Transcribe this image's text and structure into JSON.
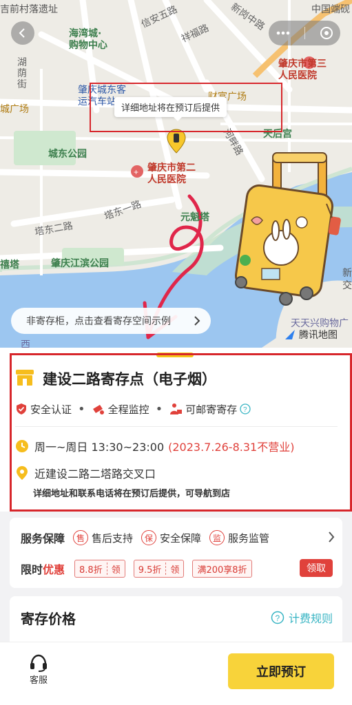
{
  "map": {
    "labels": {
      "village": "吉前村落遗址",
      "xinan": "信安五路",
      "xiangfu": "祥福路",
      "xingang": "新岗中路",
      "zhongguo": "中国端砚",
      "haiwan": "海湾城·",
      "haiwan2": "购物中心",
      "hupin": "湖",
      "hupin2": "荫",
      "hupin3": "街",
      "station": "肇庆城东客",
      "station2": "运汽车站",
      "caifu": "财富广场",
      "third": "肇庆市第三",
      "third2": "人民医院",
      "plaza": "城广场",
      "tianhou": "天后宫",
      "hepan": "河畔路",
      "park": "城东公园",
      "second": "肇庆市第二",
      "second2": "人民医院",
      "tadong1": "塔东一路",
      "tadong2": "塔东二路",
      "yuankui": "元魁塔",
      "xiangta": "禧塔",
      "jiangbin": "肇庆江滨公园",
      "xin": "新",
      "jiao": "交",
      "tiantian": "天天兴购物广",
      "xi": "西"
    },
    "tooltip": "详细地址将在预订后提供",
    "notice_pill": "非寄存柜，点击查看寄存空间示例",
    "provider": "腾讯地图"
  },
  "store": {
    "name": "建设二路寄存点（电子烟）",
    "features": [
      "安全认证",
      "全程监控",
      "可邮寄寄存"
    ],
    "feature_sep": "•",
    "hours": "周一~周日 13:30~23:00",
    "closed_note": "(2023.7.26-8.31不营业)",
    "address": "近建设二路二塔路交叉口",
    "address_note": "详细地址和联系电话将在预订后提供，可导航到店"
  },
  "service": {
    "title": "服务保障",
    "items": [
      {
        "badge": "售",
        "label": "售后支持"
      },
      {
        "badge": "保",
        "label": "安全保障"
      },
      {
        "badge": "监",
        "label": "服务监管"
      }
    ],
    "promo_title_a": "限时",
    "promo_title_b": "优惠",
    "coupons": [
      {
        "text": "8.8折",
        "action": "领"
      },
      {
        "text": "9.5折",
        "action": "领"
      },
      {
        "text": "满200享8折",
        "action": ""
      }
    ],
    "claim": "领取"
  },
  "price": {
    "title": "寄存价格",
    "rule": "计费规则"
  },
  "bottom": {
    "cs_label": "客服",
    "book": "立即预订"
  },
  "colors": {
    "accent_red": "#e0413b",
    "accent_yellow": "#f8d33a",
    "rule_teal": "#37b4c3"
  }
}
